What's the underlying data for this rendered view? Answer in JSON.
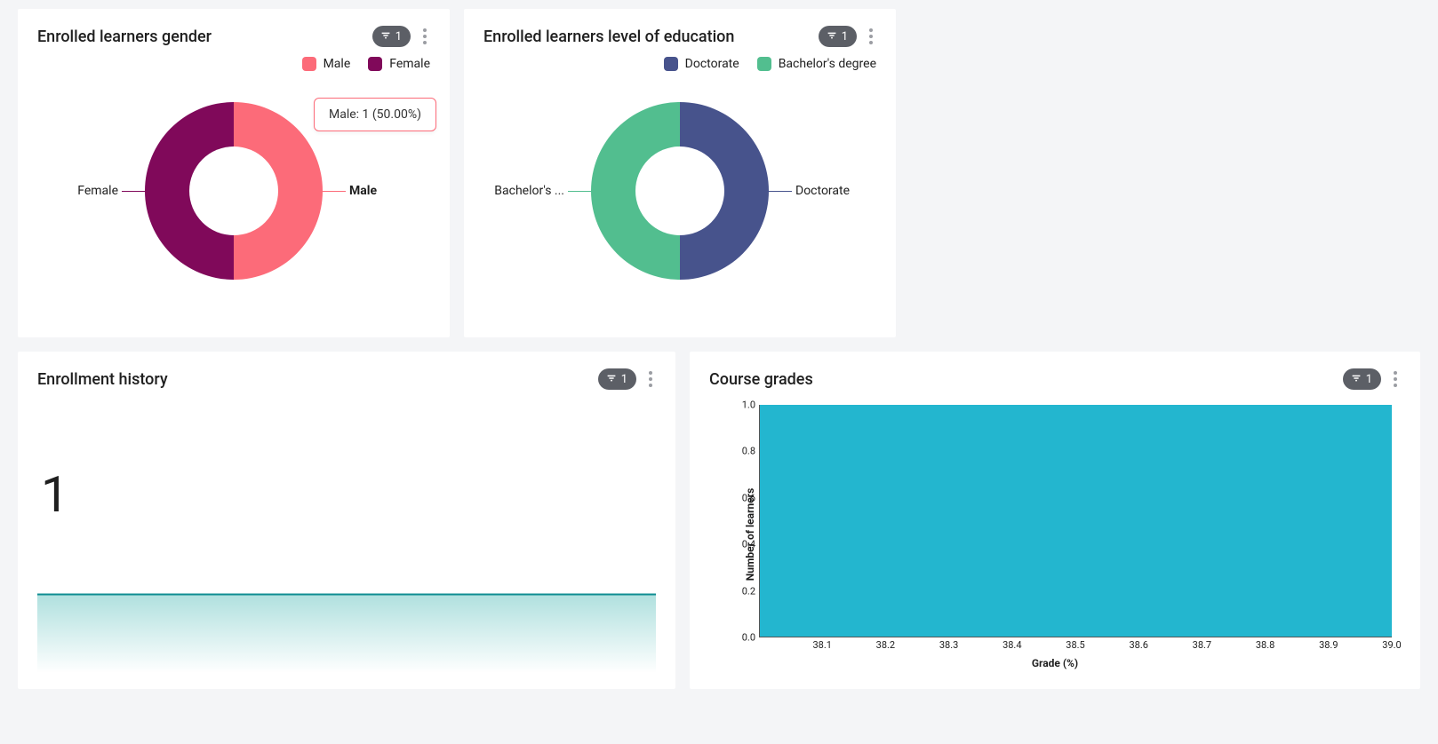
{
  "cards": {
    "gender": {
      "title": "Enrolled learners gender",
      "filter_count": "1",
      "legend": [
        {
          "label": "Male",
          "color": "#fc6b79"
        },
        {
          "label": "Female",
          "color": "#80095a"
        }
      ],
      "label_right": "Male",
      "label_left": "Female",
      "tooltip": "Male: 1 (50.00%)"
    },
    "education": {
      "title": "Enrolled learners level of education",
      "filter_count": "1",
      "legend": [
        {
          "label": "Doctorate",
          "color": "#47538c"
        },
        {
          "label": "Bachelor's degree",
          "color": "#52be8f"
        }
      ],
      "label_right": "Doctorate",
      "label_left": "Bachelor's ..."
    },
    "history": {
      "title": "Enrollment history",
      "filter_count": "1",
      "value": "1"
    },
    "grades": {
      "title": "Course grades",
      "filter_count": "1",
      "ylabel": "Number of learners",
      "xlabel": "Grade (%)",
      "y_ticks": [
        "0.0",
        "0.2",
        "0.4",
        "0.6",
        "0.8",
        "1.0"
      ],
      "x_ticks": [
        "38.1",
        "38.2",
        "38.3",
        "38.4",
        "38.5",
        "38.6",
        "38.7",
        "38.8",
        "38.9",
        "39.0"
      ]
    }
  },
  "chart_data": [
    {
      "type": "pie",
      "title": "Enrolled learners gender",
      "series": [
        {
          "name": "Male",
          "value": 1,
          "percent": 50.0,
          "color": "#fc6b79"
        },
        {
          "name": "Female",
          "value": 1,
          "percent": 50.0,
          "color": "#80095a"
        }
      ]
    },
    {
      "type": "pie",
      "title": "Enrolled learners level of education",
      "series": [
        {
          "name": "Doctorate",
          "value": 1,
          "percent": 50.0,
          "color": "#47538c"
        },
        {
          "name": "Bachelor's degree",
          "value": 1,
          "percent": 50.0,
          "color": "#52be8f"
        }
      ]
    },
    {
      "type": "area",
      "title": "Enrollment history",
      "latest_value": 1,
      "values": [
        1,
        1,
        1,
        1,
        1,
        1,
        1,
        1,
        1,
        1,
        1,
        1
      ],
      "ylim": [
        0,
        1
      ]
    },
    {
      "type": "bar",
      "title": "Course grades",
      "xlabel": "Grade (%)",
      "ylabel": "Number of learners",
      "xlim": [
        38.0,
        39.0
      ],
      "ylim": [
        0.0,
        1.0
      ],
      "bars": [
        {
          "x_start": 38.0,
          "x_end": 39.0,
          "value": 1.0
        }
      ]
    }
  ]
}
